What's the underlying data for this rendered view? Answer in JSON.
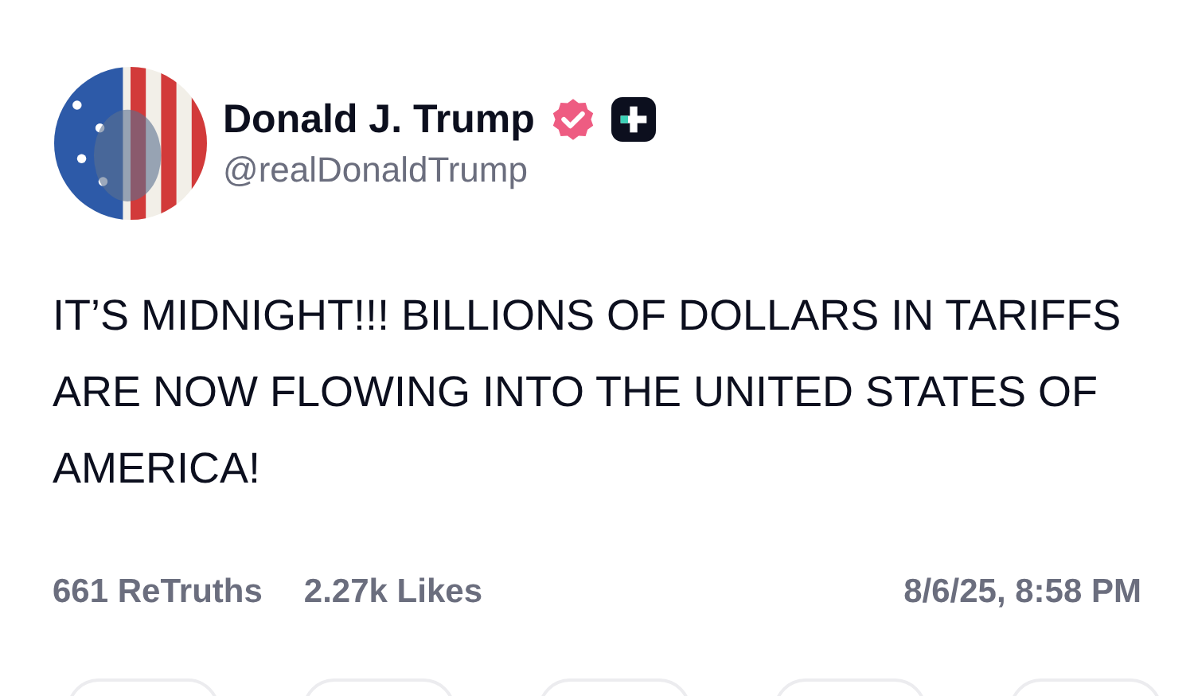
{
  "author": {
    "name": "Donald J. Trump",
    "handle": "@realDonaldTrump",
    "verified": true
  },
  "post": {
    "text": "IT’S MIDNIGHT!!! BILLIONS OF DOLLARS IN TARIFFS ARE NOW FLOWING INTO THE UNITED STATES OF AMERICA!"
  },
  "stats": [
    "**661** ReTruths",
    "**2.27k** Likes"
  ],
  "timestamp": "8/6/25, 8:58 PM"
}
